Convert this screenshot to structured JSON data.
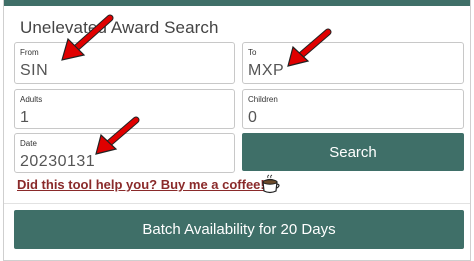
{
  "title": "Unelevated Award Search",
  "from": {
    "label": "From",
    "value": "SIN"
  },
  "to": {
    "label": "To",
    "value": "MXP"
  },
  "adults": {
    "label": "Adults",
    "value": "1"
  },
  "children": {
    "label": "Children",
    "value": "0"
  },
  "date": {
    "label": "Date",
    "value": "20230131"
  },
  "search_button": "Search",
  "coffee_link": "Did this tool help you? Buy me a coffee!",
  "coffee_icon": "coffee-mug-icon",
  "batch_button": "Batch Availability for 20 Days",
  "colors": {
    "accent": "#3f6f68",
    "link": "#8a2a2a",
    "arrow": "#e00000"
  }
}
